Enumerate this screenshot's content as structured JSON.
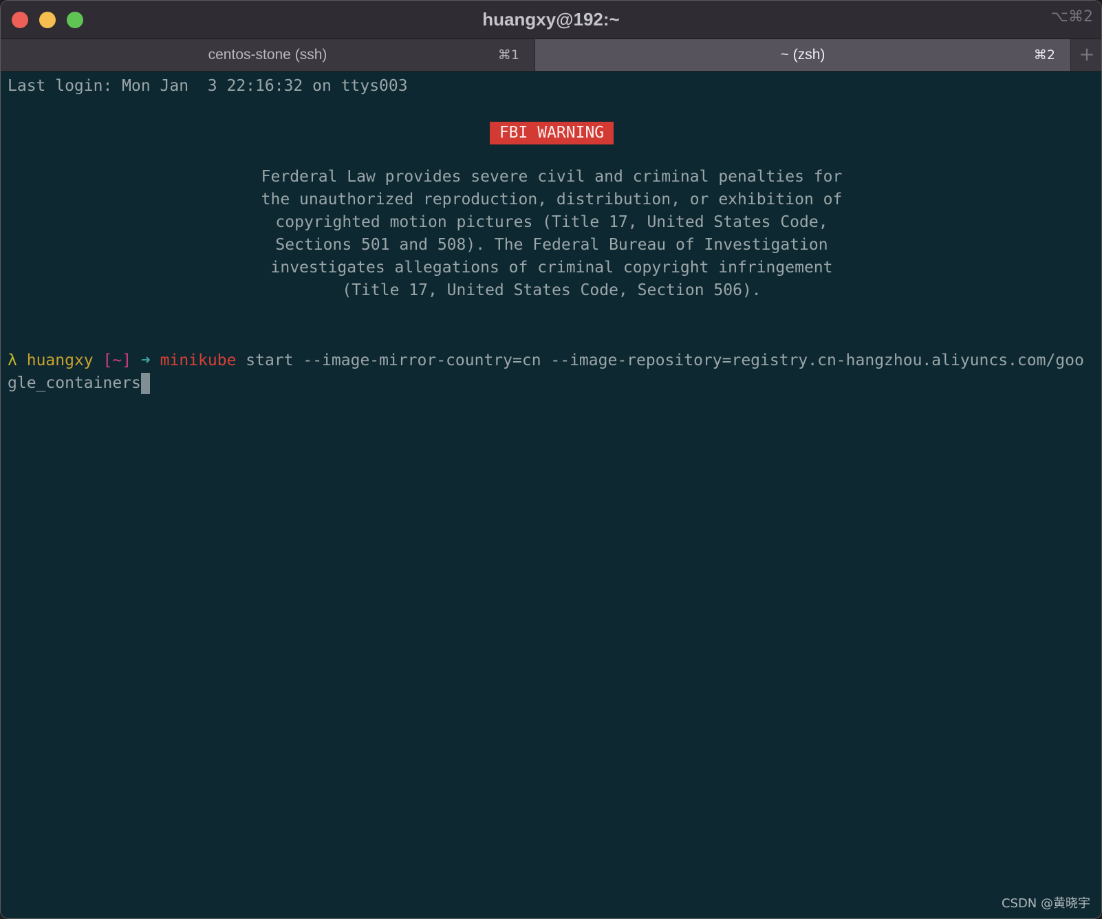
{
  "window": {
    "title": "huangxy@192:~",
    "title_shortcut": "⌥⌘2"
  },
  "tabs": [
    {
      "label": "centos-stone (ssh)",
      "shortcut": "⌘1",
      "active": false
    },
    {
      "label": "~ (zsh)",
      "shortcut": "⌘2",
      "active": true
    }
  ],
  "tab_add_label": "+",
  "terminal": {
    "last_login": "Last login: Mon Jan  3 22:16:32 on ttys003",
    "banner": "FBI WARNING",
    "warning_lines": [
      "Ferderal Law provides severe civil and criminal penalties for",
      "the unauthorized reproduction, distribution, or exhibition of",
      "copyrighted motion pictures (Title 17, United States Code,",
      "Sections 501 and 508). The Federal Bureau of Investigation",
      "investigates allegations of criminal copyright infringement",
      "(Title 17, United States Code, Section 506)."
    ],
    "prompt": {
      "lambda": "λ",
      "user": "huangxy",
      "path": "[~]",
      "arrow": "➜",
      "command": "minikube",
      "args_line1": "start --image-mirror-country=cn --image-repository=registry.cn-hangzhou.aliyuncs.com/goo",
      "args_line2": "gle_containers"
    }
  },
  "watermark": "CSDN @黄晓宇",
  "colors": {
    "terminal_bg": "#0e2832",
    "banner_bg": "#d23a33",
    "prompt_user": "#c8a32c",
    "prompt_path": "#d43d84",
    "prompt_command": "#d84034"
  }
}
